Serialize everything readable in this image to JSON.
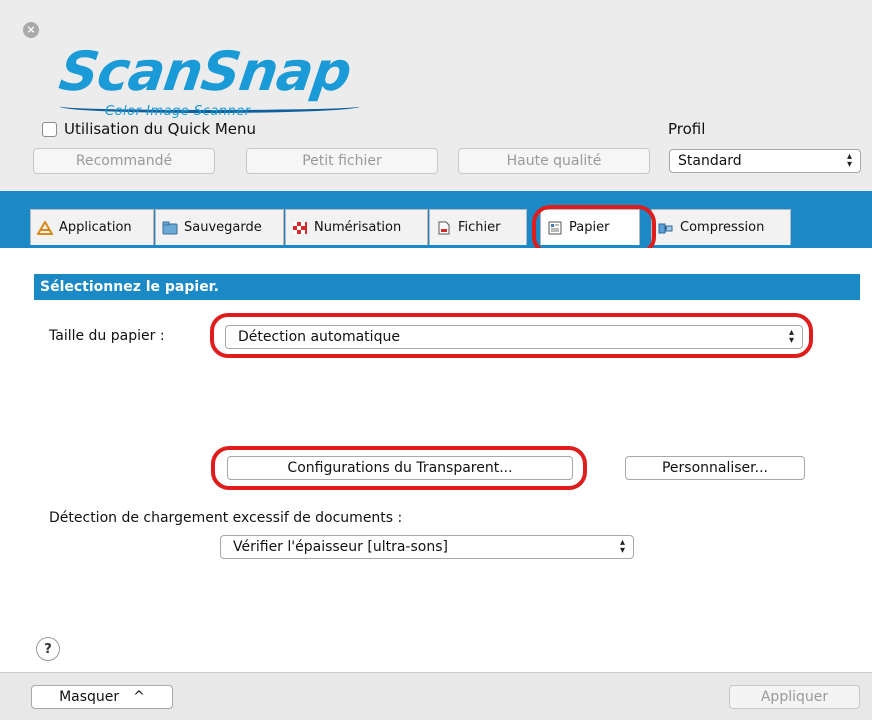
{
  "window": {
    "close_glyph": "×",
    "logo": {
      "brand": "ScanSnap",
      "subtitle": "Color Image Scanner"
    }
  },
  "quick_menu": {
    "label": "Utilisation du Quick Menu",
    "checked": false
  },
  "profile": {
    "label": "Profil",
    "selected": "Standard",
    "presets": [
      "Recommandé",
      "Petit fichier",
      "Haute qualité"
    ]
  },
  "tabs": [
    {
      "label": "Application",
      "icon": "application-icon",
      "active": false
    },
    {
      "label": "Sauvegarde",
      "icon": "folder-icon",
      "active": false
    },
    {
      "label": "Numérisation",
      "icon": "scan-mode-icon",
      "active": false
    },
    {
      "label": "Fichier",
      "icon": "file-icon",
      "active": false
    },
    {
      "label": "Papier",
      "icon": "paper-icon",
      "active": true
    },
    {
      "label": "Compression",
      "icon": "compression-icon",
      "active": false
    }
  ],
  "paper": {
    "section_title": "Sélectionnez le papier.",
    "size_label": "Taille du papier :",
    "size_value": "Détection automatique",
    "carrier_button": "Configurations du Transparent...",
    "custom_button": "Personnaliser...",
    "multifeed_label": "Détection de chargement excessif de documents :",
    "multifeed_value": "Vérifier l'épaisseur [ultra-sons]"
  },
  "footer": {
    "help": "?",
    "hide_button": "Masquer",
    "hide_chevron": "^",
    "apply_button": "Appliquer"
  },
  "colors": {
    "accent_blue": "#1a89c6",
    "logo_blue": "#1a9ad6",
    "highlight_red": "#e01d1d"
  }
}
